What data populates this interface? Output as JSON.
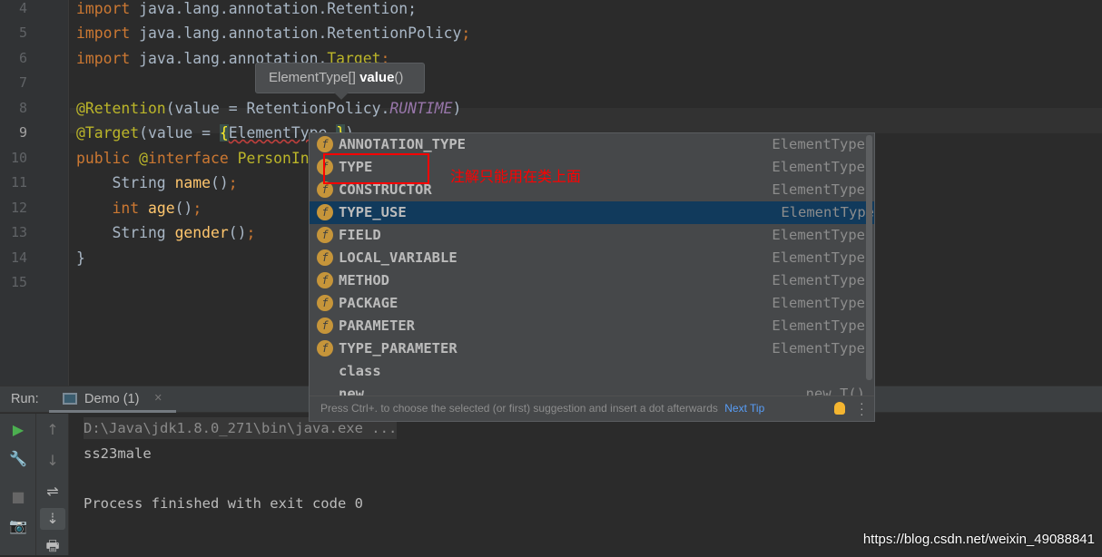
{
  "editor": {
    "lines": [
      {
        "n": "4",
        "parts": [
          [
            "kw",
            "import "
          ],
          [
            "",
            "java.lang.annotation.Retention;"
          ]
        ]
      },
      {
        "n": "5",
        "parts": [
          [
            "kw",
            "import "
          ],
          [
            "",
            "java.lang.annotation.RetentionPolicy"
          ],
          [
            "kw",
            ";"
          ]
        ]
      },
      {
        "n": "6",
        "parts": [
          [
            "kw",
            "import "
          ],
          [
            "",
            "java.lang.annotation."
          ],
          [
            "ann",
            "Target"
          ],
          [
            "kw",
            ";"
          ]
        ]
      },
      {
        "n": "7",
        "parts": []
      },
      {
        "n": "8",
        "parts": [
          [
            "ann",
            "@Retention"
          ],
          [
            "",
            "(value = RetentionPolicy."
          ],
          [
            "const",
            "RUNTIME"
          ],
          [
            "",
            ")"
          ]
        ]
      },
      {
        "n": "9",
        "parts": [
          [
            "ann",
            "@Target"
          ],
          [
            "",
            "(value = "
          ],
          [
            "brace",
            "{"
          ],
          [
            "err",
            "ElementType."
          ],
          [
            "brace",
            "}"
          ],
          [
            "",
            ")"
          ]
        ]
      },
      {
        "n": "10",
        "parts": [
          [
            "kw",
            "public "
          ],
          [
            "ann",
            "@"
          ],
          [
            "kw",
            "interface "
          ],
          [
            "ann",
            "PersonInfo"
          ],
          [
            "",
            "{"
          ]
        ]
      },
      {
        "n": "11",
        "parts": [
          [
            "",
            "    String "
          ],
          [
            "fn",
            "name"
          ],
          [
            "",
            "()"
          ],
          [
            "kw",
            ";"
          ]
        ]
      },
      {
        "n": "12",
        "parts": [
          [
            "kw",
            "    int "
          ],
          [
            "fn",
            "age"
          ],
          [
            "",
            "()"
          ],
          [
            "kw",
            ";"
          ]
        ]
      },
      {
        "n": "13",
        "parts": [
          [
            "",
            "    String "
          ],
          [
            "fn",
            "gender"
          ],
          [
            "",
            "()"
          ],
          [
            "kw",
            ";"
          ]
        ]
      },
      {
        "n": "14",
        "parts": [
          [
            "",
            "}"
          ]
        ]
      },
      {
        "n": "15",
        "parts": []
      }
    ],
    "hint": {
      "type": "ElementType[]",
      "name": "value",
      "parens": "()"
    }
  },
  "completion": {
    "items": [
      {
        "name": "ANNOTATION_TYPE",
        "type": "ElementType",
        "icon": "f"
      },
      {
        "name": "TYPE",
        "type": "ElementType",
        "icon": "f"
      },
      {
        "name": "CONSTRUCTOR",
        "type": "ElementType",
        "icon": "f"
      },
      {
        "name": "TYPE_USE",
        "type": "ElementType",
        "icon": "f",
        "selected": true
      },
      {
        "name": "FIELD",
        "type": "ElementType",
        "icon": "f"
      },
      {
        "name": "LOCAL_VARIABLE",
        "type": "ElementType",
        "icon": "f"
      },
      {
        "name": "METHOD",
        "type": "ElementType",
        "icon": "f"
      },
      {
        "name": "PACKAGE",
        "type": "ElementType",
        "icon": "f"
      },
      {
        "name": "PARAMETER",
        "type": "ElementType",
        "icon": "f"
      },
      {
        "name": "TYPE_PARAMETER",
        "type": "ElementType",
        "icon": "f"
      },
      {
        "name": "class",
        "type": "",
        "icon": ""
      },
      {
        "name": "new",
        "type": "new T()",
        "icon": ""
      }
    ],
    "footer": "Press Ctrl+. to choose the selected (or first) suggestion and insert a dot afterwards",
    "next_tip": "Next Tip",
    "annotation": "注解只能用在类上面"
  },
  "run": {
    "label": "Run:",
    "tab": "Demo (1)",
    "close": "×",
    "output": [
      "D:\\Java\\jdk1.8.0_271\\bin\\java.exe ...",
      "ss23male",
      "",
      "Process finished with exit code 0"
    ]
  },
  "watermark": "https://blog.csdn.net/weixin_49088841"
}
